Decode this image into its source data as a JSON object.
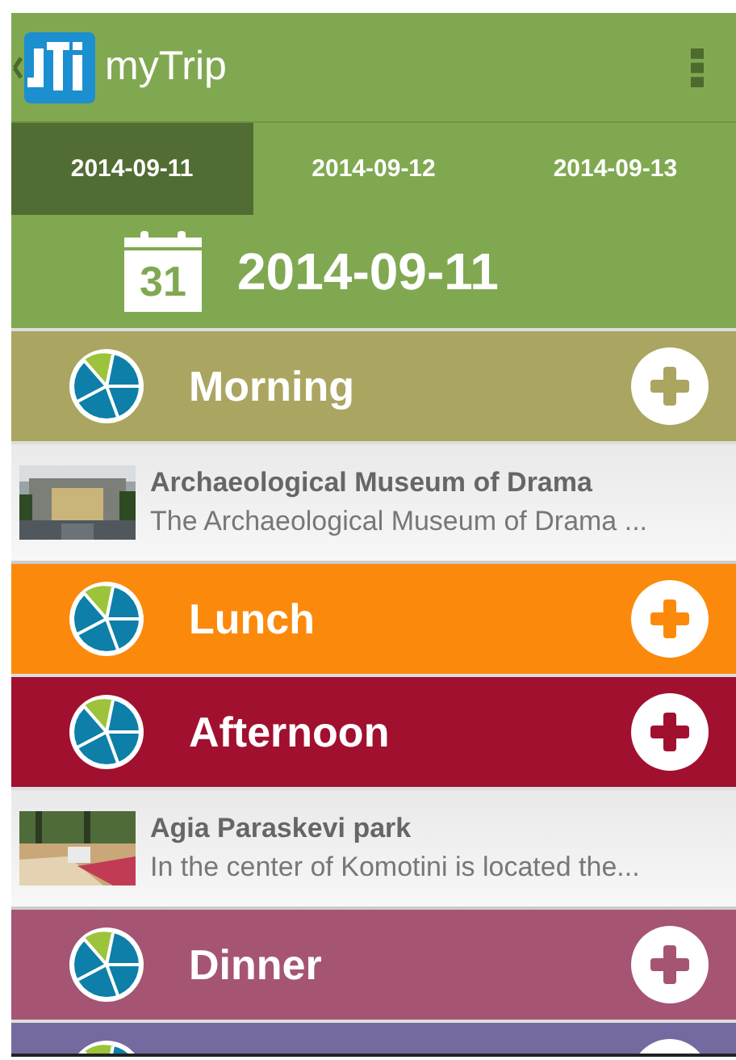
{
  "app_bar": {
    "title": "myTrip"
  },
  "tabs": [
    {
      "label": "2014-09-11",
      "selected": true
    },
    {
      "label": "2014-09-12",
      "selected": false
    },
    {
      "label": "2014-09-13",
      "selected": false
    }
  ],
  "date_header": {
    "icon_day": "31",
    "date": "2014-09-11"
  },
  "items": [
    {
      "kind": "section",
      "title": "Morning",
      "color": "#aaa560"
    },
    {
      "kind": "place",
      "title": "Archaeological Museum of Drama",
      "description": "The Archaeological Museum of Drama ..."
    },
    {
      "kind": "section",
      "title": "Lunch",
      "color": "#fb8a0c"
    },
    {
      "kind": "section",
      "title": "Afternoon",
      "color": "#a1102f"
    },
    {
      "kind": "place",
      "title": "Agia Paraskevi park",
      "description": "In the center of Komotini is located the..."
    },
    {
      "kind": "section",
      "title": "Dinner",
      "color": "#a65474"
    },
    {
      "kind": "section",
      "color": "#746aa0"
    }
  ]
}
